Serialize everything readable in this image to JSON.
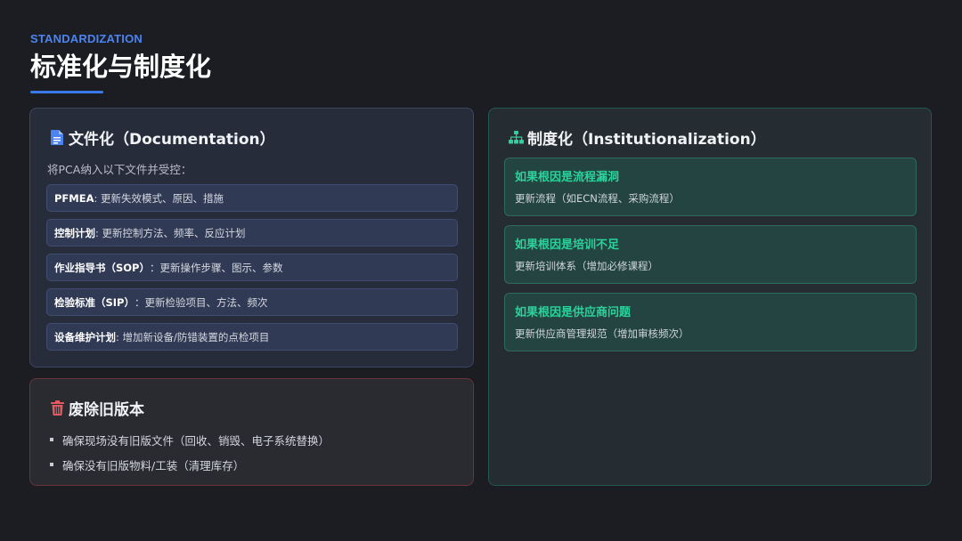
{
  "header": {
    "kicker": "STANDARDIZATION",
    "title": "标准化与制度化"
  },
  "colors": {
    "accent_blue": "#3b78ea",
    "accent_green": "#2ad39b",
    "accent_red": "#e05a5f",
    "background": "#1b1d22"
  },
  "documentation": {
    "icon": "document-icon",
    "title": "文件化（Documentation）",
    "intro": "将PCA纳入以下文件并受控：",
    "items": [
      {
        "label": "PFMEA",
        "text": ": 更新失效模式、原因、措施"
      },
      {
        "label": "控制计划",
        "text": ": 更新控制方法、频率、反应计划"
      },
      {
        "label": "作业指导书（SOP）",
        "text": "：更新操作步骤、图示、参数"
      },
      {
        "label": "检验标准（SIP）",
        "text": "：更新检验项目、方法、频次"
      },
      {
        "label": "设备维护计划",
        "text": ": 增加新设备/防错装置的点检项目"
      }
    ]
  },
  "deprecate": {
    "icon": "trash-icon",
    "title": "废除旧版本",
    "bullets": [
      "确保现场没有旧版文件（回收、销毁、电子系统替换）",
      "确保没有旧版物料/工装（清理库存）"
    ]
  },
  "institutionalization": {
    "icon": "org-chart-icon",
    "title": "制度化（Institutionalization）",
    "items": [
      {
        "head": "如果根因是流程漏洞",
        "sub": "更新流程（如ECN流程、采购流程）"
      },
      {
        "head": "如果根因是培训不足",
        "sub": "更新培训体系（增加必修课程）"
      },
      {
        "head": "如果根因是供应商问题",
        "sub": "更新供应商管理规范（增加审核频次）"
      }
    ]
  }
}
